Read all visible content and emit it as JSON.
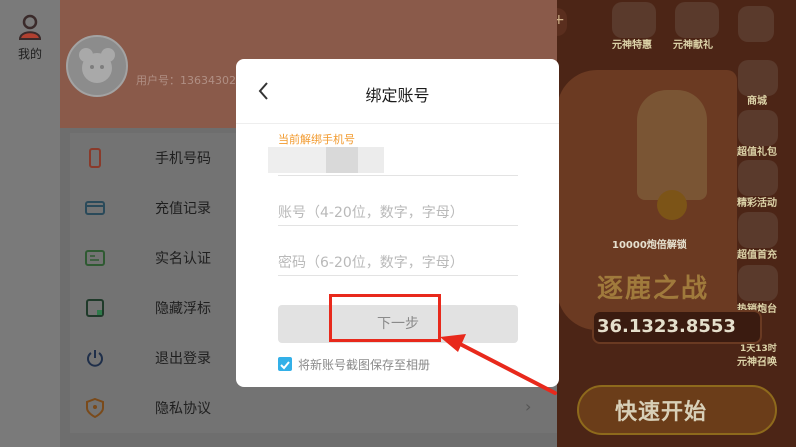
{
  "rail": {
    "label": "我的"
  },
  "profile": {
    "user_id_text": "用户号：13634302"
  },
  "menu": {
    "items": [
      {
        "label": "手机号码",
        "icon": "phone-icon"
      },
      {
        "label": "充值记录",
        "icon": "card-icon"
      },
      {
        "label": "实名认证",
        "icon": "id-card-icon"
      },
      {
        "label": "隐藏浮标",
        "icon": "float-hide-icon"
      },
      {
        "label": "退出登录",
        "icon": "power-icon"
      },
      {
        "label": "隐私协议",
        "icon": "shield-icon"
      }
    ]
  },
  "dialog": {
    "title": "绑定账号",
    "hint": "当前解绑手机号",
    "account_placeholder": "账号（4-20位，数字，字母）",
    "password_placeholder": "密码（6-20位，数字，字母）",
    "next_label": "下一步",
    "save_screenshot_label": "将新账号截图保存至相册",
    "save_screenshot_checked": true
  },
  "game": {
    "icons": [
      {
        "label": "元神特惠"
      },
      {
        "label": "元神献礼"
      },
      {
        "label": "商城"
      },
      {
        "label": "超值礼包"
      },
      {
        "label": "精彩活动"
      },
      {
        "label": "超值首充"
      },
      {
        "label": "热销炮台"
      },
      {
        "label": "元神召唤"
      }
    ],
    "timer": "1天13时",
    "banner_text": "10000炮倍解锁",
    "title_art": "逐鹿之战",
    "score": "36.1323.8553",
    "quick_start": "快速开始"
  },
  "colors": {
    "accent_orange": "#f29a2e",
    "checkbox_blue": "#33b0e8",
    "annotation_red": "#e8291c"
  }
}
